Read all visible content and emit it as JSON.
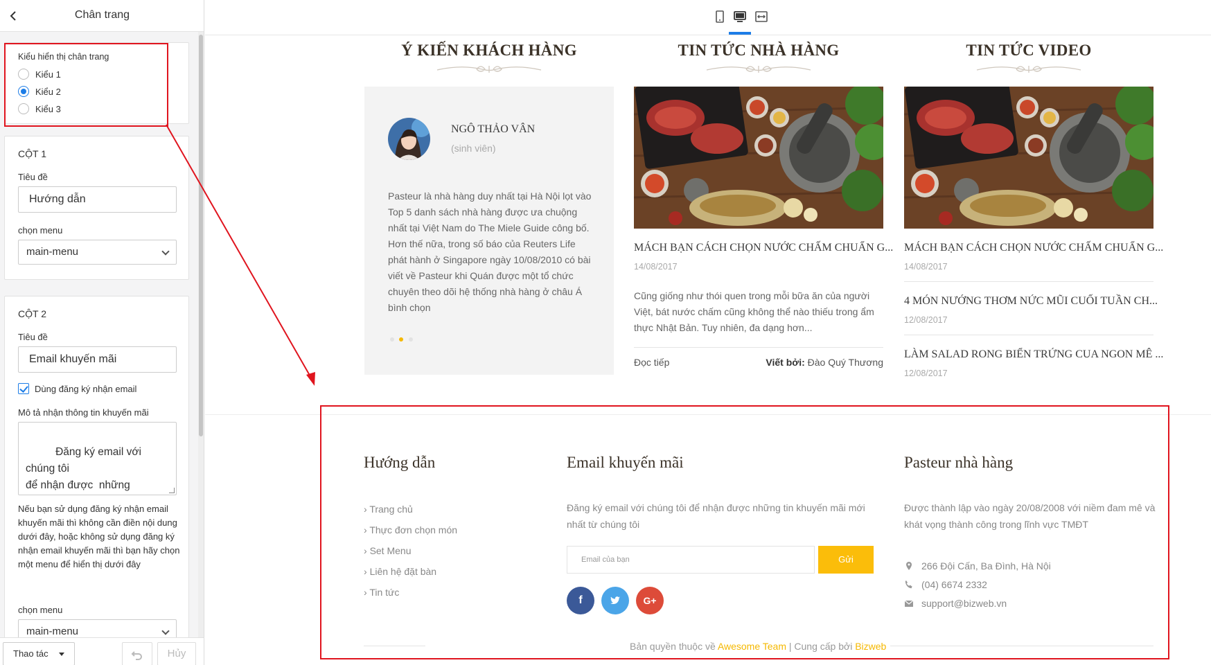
{
  "panel": {
    "title": "Chân trang",
    "display_style": {
      "label": "Kiểu hiển thị chân trang",
      "options": [
        "Kiểu 1",
        "Kiểu 2",
        "Kiểu 3"
      ],
      "selected": "Kiểu 2"
    },
    "col1": {
      "heading": "CỘT 1",
      "title_label": "Tiêu đề",
      "title_value": "Hướng dẫn",
      "menu_label": "chọn menu",
      "menu_value": "main-menu"
    },
    "col2": {
      "heading": "CỘT 2",
      "title_label": "Tiêu đề",
      "title_value": "Email khuyến mãi",
      "checkbox_label": "Dùng đăng ký nhận email",
      "checkbox_checked": true,
      "desc_label": "Mô tả nhận thông tin khuyến mãi",
      "desc_value": "Đăng ký email với chúng tôi\nđể nhận được  những\ntin khuyến mãi mới nhất từ\nchúng tôi",
      "note": "Nếu bạn sử dụng đăng ký nhận email khuyến mãi thì không cần điền nội dung dưới đây, hoặc không sử dụng đăng ký nhận email khuyến mãi thì bạn hãy chọn một menu để hiển thị dưới đây",
      "menu_label": "chọn menu",
      "menu_value": "main-menu"
    },
    "footer": {
      "actions_label": "Thao tác",
      "cancel_label": "Hủy"
    }
  },
  "toolbar": {
    "devices": [
      "mobile-icon",
      "desktop-icon",
      "fullwidth-icon"
    ],
    "active_device": "desktop-icon"
  },
  "preview": {
    "testimonials": {
      "heading": "Ý KIẾN KHÁCH HÀNG",
      "name": "NGÔ THẢO VÂN",
      "role": "(sinh viên)",
      "text": "Pasteur là nhà hàng duy nhất tại Hà Nội lọt vào Top 5 danh sách nhà hàng được ưa chuộng nhất tại Việt Nam do The Miele Guide công bố. Hơn thế nữa, trong số báo của Reuters Life phát hành ở Singapore ngày 10/08/2010 có bài viết về Pasteur khi Quán được một tổ chức chuyên theo dõi hệ thống nhà hàng ở châu Á bình chọn",
      "slide_count": 3,
      "active_slide": 2
    },
    "restaurant_news": {
      "heading": "TIN TỨC NHÀ HÀNG",
      "title": "MÁCH BẠN CÁCH CHỌN NƯỚC CHẤM CHUẨN G...",
      "date": "14/08/2017",
      "excerpt": "Cũng giống như thói quen trong mỗi bữa ăn của người Việt, bát nước chấm cũng không thể nào thiếu trong ẩm thực Nhật Bản. Tuy nhiên, đa dạng hơn...",
      "read_more": "Đọc tiếp",
      "author_label": "Viết bởi:",
      "author_name": "Đào Quý Thương"
    },
    "video_news": {
      "heading": "TIN TỨC VIDEO",
      "items": [
        {
          "title": "MÁCH BẠN CÁCH CHỌN NƯỚC CHẤM CHUẨN G...",
          "date": "14/08/2017"
        },
        {
          "title": "4 MÓN NƯỚNG THƠM NỨC MŨI CUỐI TUẦN CH...",
          "date": "12/08/2017"
        },
        {
          "title": "LÀM SALAD RONG BIỂN TRỨNG CUA NGON MÊ ...",
          "date": "12/08/2017"
        }
      ]
    }
  },
  "site_footer": {
    "guide": {
      "heading": "Hướng dẫn",
      "links": [
        "Trang chủ",
        "Thực đơn chọn món",
        "Set Menu",
        "Liên hệ đặt bàn",
        "Tin tức"
      ]
    },
    "promo": {
      "heading": "Email khuyến mãi",
      "desc": "Đăng ký email với chúng tôi để nhận được những tin khuyến mãi mới nhất từ chúng tôi",
      "email_placeholder": "Email của bạn",
      "send_label": "Gửi",
      "social": [
        "facebook-icon",
        "twitter-icon",
        "google-plus-icon"
      ]
    },
    "about": {
      "heading": "Pasteur nhà hàng",
      "text": "Được thành lập vào ngày 20/08/2008 với niềm đam mê và khát vọng thành công trong lĩnh vực TMĐT",
      "address": "266 Đội Cấn, Ba Đình, Hà Nội",
      "phone": "(04) 6674 2332",
      "email": "support@bizweb.vn"
    },
    "copyright": {
      "prefix": "Bản quyền thuộc về",
      "team": "Awesome Team",
      "middle": "| Cung cấp bởi",
      "provider": "Bizweb"
    }
  },
  "colors": {
    "accent_blue": "#1d7de7",
    "annotation_red": "#e0141e",
    "send_yellow": "#fbbd0a",
    "facebook": "#3b5998",
    "twitter": "#4ba5e8",
    "google_plus": "#dd4b39"
  }
}
